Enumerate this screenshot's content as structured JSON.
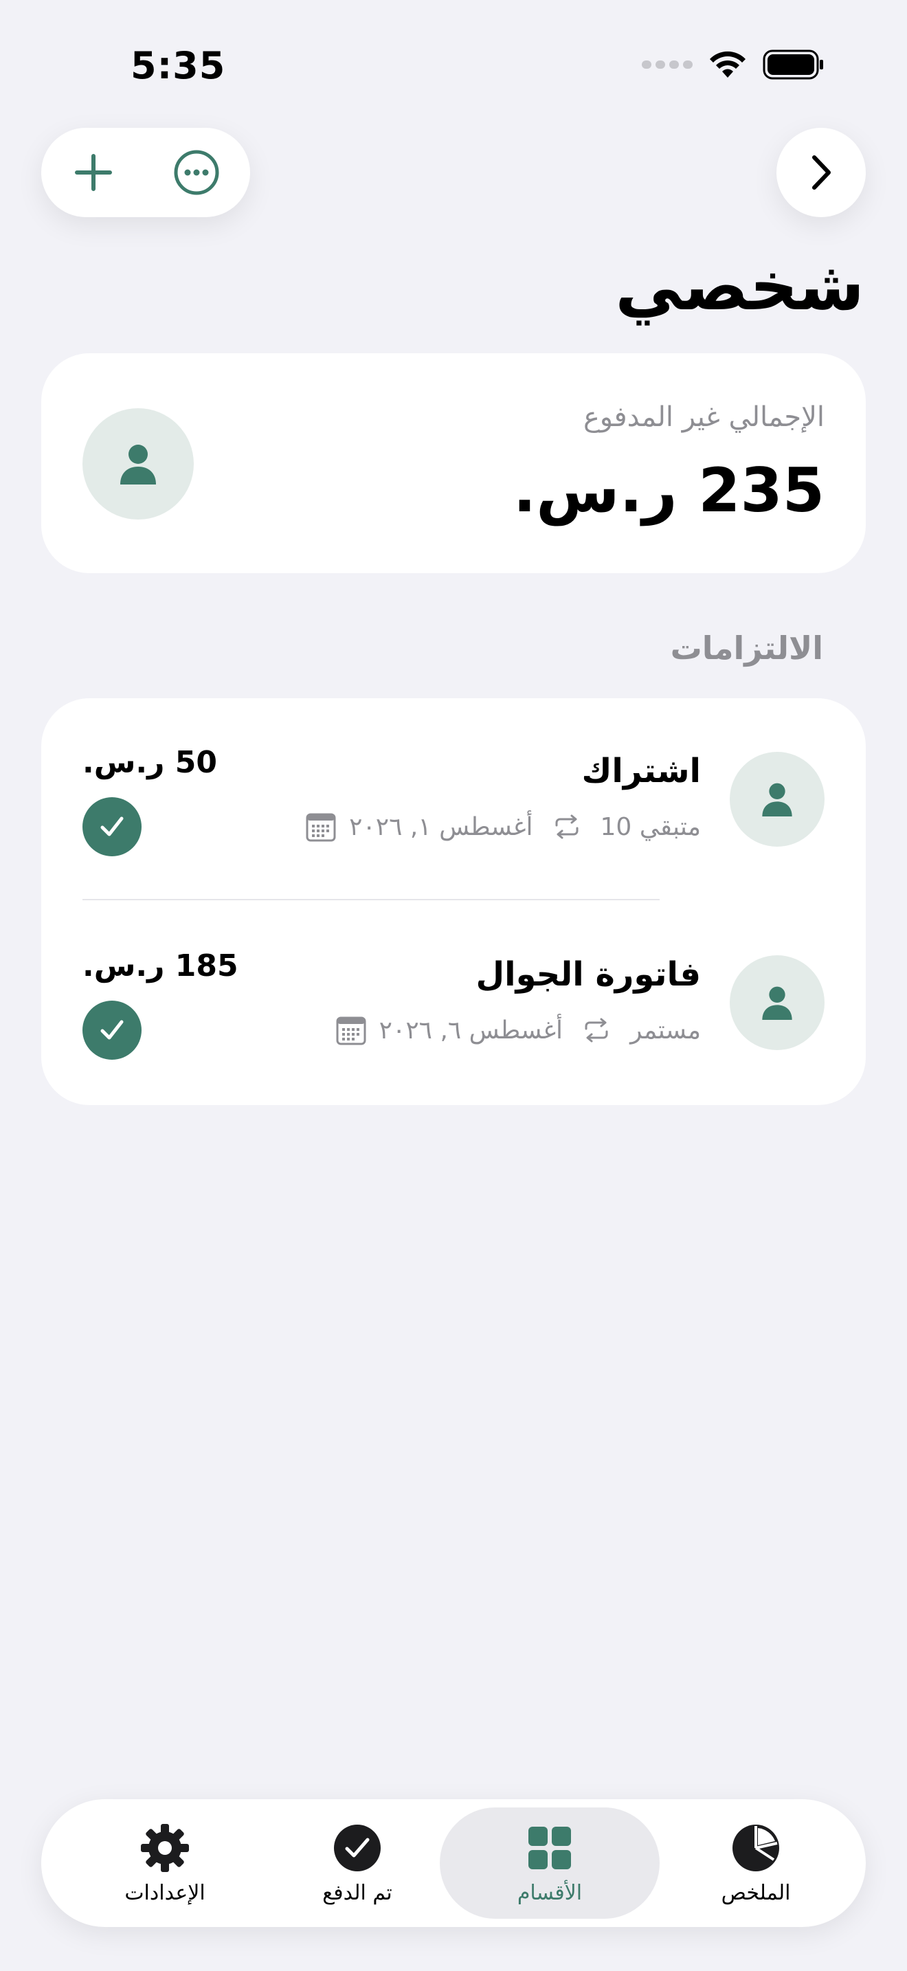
{
  "status_bar": {
    "time": "5:35"
  },
  "page": {
    "title": "شخصي"
  },
  "summary": {
    "label": "الإجمالي غير المدفوع",
    "amount": "235 ر.س."
  },
  "commitments": {
    "header": "الالتزامات",
    "items": [
      {
        "title": "اشتراك",
        "date": "أغسطس ١, ٢٠٢٦",
        "recurrence": "متبقي 10",
        "amount": "50 ر.س.",
        "paid": true
      },
      {
        "title": "فاتورة الجوال",
        "date": "أغسطس ٦, ٢٠٢٦",
        "recurrence": "مستمر",
        "amount": "185 ر.س.",
        "paid": true
      }
    ]
  },
  "tabs": [
    {
      "label": "الملخص",
      "icon": "pie-chart-icon",
      "active": false
    },
    {
      "label": "الأقسام",
      "icon": "grid-icon",
      "active": true
    },
    {
      "label": "تم الدفع",
      "icon": "checkmark-circle-icon",
      "active": false
    },
    {
      "label": "الإعدادات",
      "icon": "gear-icon",
      "active": false
    }
  ],
  "colors": {
    "accent": "#3d7b6b",
    "avatar_bg": "#e3ebe8",
    "background": "#f2f2f7"
  }
}
